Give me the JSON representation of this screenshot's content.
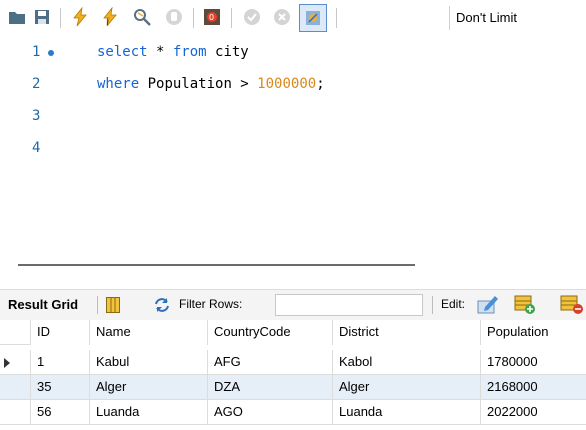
{
  "toolbar": {
    "limit_label": "Don't Limit",
    "icons": [
      "open-file-icon",
      "save-icon",
      "execute-icon",
      "execute-current-icon",
      "explain-icon",
      "stop-icon",
      "toggle-errors-icon",
      "commit-icon",
      "rollback-icon",
      "autocommit-icon"
    ]
  },
  "editor": {
    "lines": [
      {
        "number": "1",
        "tokens": [
          [
            "kw",
            "select"
          ],
          [
            "t",
            " * "
          ],
          [
            "kw",
            "from"
          ],
          [
            "t",
            " city"
          ]
        ]
      },
      {
        "number": "2",
        "tokens": [
          [
            "kw",
            "where"
          ],
          [
            "t",
            " Population > "
          ],
          [
            "num",
            "1000000"
          ],
          [
            "t",
            ";"
          ]
        ]
      },
      {
        "number": "3",
        "tokens": []
      },
      {
        "number": "4",
        "tokens": []
      }
    ]
  },
  "result": {
    "grid_label": "Result Grid",
    "filter_label": "Filter Rows:",
    "filter_value": "",
    "edit_label": "Edit:",
    "columns": [
      "ID",
      "Name",
      "CountryCode",
      "District",
      "Population"
    ],
    "rows": [
      [
        "1",
        "Kabul",
        "AFG",
        "Kabol",
        "1780000"
      ],
      [
        "35",
        "Alger",
        "DZA",
        "Alger",
        "2168000"
      ],
      [
        "56",
        "Luanda",
        "AGO",
        "Luanda",
        "2022000"
      ]
    ],
    "current_row": 0,
    "selected_row": 1
  },
  "colors": {
    "keyword": "#1565d8",
    "number": "#d9891b",
    "line_number": "#1e6aa7",
    "selected_row": "#e6eef8"
  }
}
